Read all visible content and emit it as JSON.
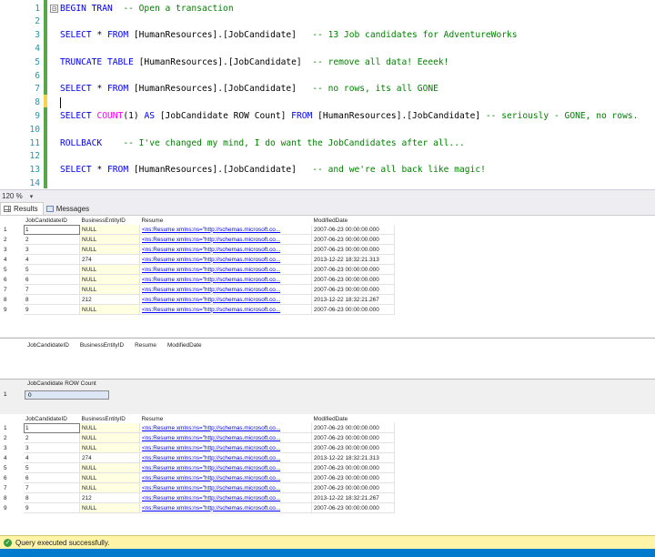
{
  "editor": {
    "lines": [
      {
        "num": "1",
        "fold": "⊟",
        "segs": [
          {
            "c": "kw",
            "t": "BEGIN TRAN"
          },
          {
            "c": "cm",
            "t": "  -- Open a transaction"
          }
        ]
      },
      {
        "num": "2",
        "segs": []
      },
      {
        "num": "3",
        "segs": [
          {
            "c": "kw",
            "t": "SELECT "
          },
          {
            "c": "tx",
            "t": "* "
          },
          {
            "c": "kw",
            "t": "FROM "
          },
          {
            "c": "tx",
            "t": "[HumanResources].[JobCandidate]"
          },
          {
            "c": "cm",
            "t": "   -- 13 Job candidates for AdventureWorks"
          }
        ]
      },
      {
        "num": "4",
        "segs": []
      },
      {
        "num": "5",
        "segs": [
          {
            "c": "kw",
            "t": "TRUNCATE TABLE "
          },
          {
            "c": "tx",
            "t": "[HumanResources].[JobCandidate]"
          },
          {
            "c": "cm",
            "t": "  -- remove all data! Eeeek!"
          }
        ]
      },
      {
        "num": "6",
        "segs": []
      },
      {
        "num": "7",
        "segs": [
          {
            "c": "kw",
            "t": "SELECT "
          },
          {
            "c": "tx",
            "t": "* "
          },
          {
            "c": "kw",
            "t": "FROM "
          },
          {
            "c": "tx",
            "t": "[HumanResources].[JobCandidate]"
          },
          {
            "c": "cm",
            "t": "   -- no rows, its all GONE"
          }
        ]
      },
      {
        "num": "8",
        "caret": true,
        "segs": []
      },
      {
        "num": "9",
        "segs": [
          {
            "c": "kw",
            "t": "SELECT "
          },
          {
            "c": "fn",
            "t": "COUNT"
          },
          {
            "c": "tx",
            "t": "(1) "
          },
          {
            "c": "kw",
            "t": "AS "
          },
          {
            "c": "tx",
            "t": "[JobCandidate ROW Count] "
          },
          {
            "c": "kw",
            "t": "FROM "
          },
          {
            "c": "tx",
            "t": "[HumanResources].[JobCandidate]"
          },
          {
            "c": "cm",
            "t": " -- seriously - GONE, no rows."
          }
        ]
      },
      {
        "num": "10",
        "segs": []
      },
      {
        "num": "11",
        "segs": [
          {
            "c": "kw",
            "t": "ROLLBACK"
          },
          {
            "c": "cm",
            "t": "    -- I've changed my mind, I do want the JobCandidates after all..."
          }
        ]
      },
      {
        "num": "12",
        "segs": []
      },
      {
        "num": "13",
        "segs": [
          {
            "c": "kw",
            "t": "SELECT "
          },
          {
            "c": "tx",
            "t": "* "
          },
          {
            "c": "kw",
            "t": "FROM "
          },
          {
            "c": "tx",
            "t": "[HumanResources].[JobCandidate]"
          },
          {
            "c": "cm",
            "t": "   -- and we're all back like magic!"
          }
        ]
      },
      {
        "num": "14",
        "segs": []
      }
    ]
  },
  "zoom": {
    "level": "120 %",
    "arrow": "▾"
  },
  "tabs": [
    {
      "label": "Results",
      "icon": "grid-icon",
      "active": true
    },
    {
      "label": "Messages",
      "icon": "messages-icon",
      "active": false
    }
  ],
  "columns": [
    "JobCandidateID",
    "BusinessEntityID",
    "Resume",
    "ModifiedDate"
  ],
  "rows": [
    {
      "n": "1",
      "id": "1",
      "be": "NULL",
      "res": "<ns:Resume xmlns:ns=\"http://schemas.microsoft.co...",
      "mod": "2007-06-23 00:00:00.000"
    },
    {
      "n": "2",
      "id": "2",
      "be": "NULL",
      "res": "<ns:Resume xmlns:ns=\"http://schemas.microsoft.co...",
      "mod": "2007-06-23 00:00:00.000"
    },
    {
      "n": "3",
      "id": "3",
      "be": "NULL",
      "res": "<ns:Resume xmlns:ns=\"http://schemas.microsoft.co...",
      "mod": "2007-06-23 00:00:00.000"
    },
    {
      "n": "4",
      "id": "4",
      "be": "274",
      "res": "<ns:Resume xmlns:ns=\"http://schemas.microsoft.co...",
      "mod": "2013-12-22 18:32:21.313"
    },
    {
      "n": "5",
      "id": "5",
      "be": "NULL",
      "res": "<ns:Resume xmlns:ns=\"http://schemas.microsoft.co...",
      "mod": "2007-06-23 00:00:00.000"
    },
    {
      "n": "6",
      "id": "6",
      "be": "NULL",
      "res": "<ns:Resume xmlns:ns=\"http://schemas.microsoft.co...",
      "mod": "2007-06-23 00:00:00.000"
    },
    {
      "n": "7",
      "id": "7",
      "be": "NULL",
      "res": "<ns:Resume xmlns:ns=\"http://schemas.microsoft.co...",
      "mod": "2007-06-23 00:00:00.000"
    },
    {
      "n": "8",
      "id": "8",
      "be": "212",
      "res": "<ns:Resume xmlns:ns=\"http://schemas.microsoft.co...",
      "mod": "2013-12-22 18:32:21.267"
    },
    {
      "n": "9",
      "id": "9",
      "be": "NULL",
      "res": "<ns:Resume xmlns:ns=\"http://schemas.microsoft.co...",
      "mod": "2007-06-23 00:00:00.000"
    }
  ],
  "count_result": {
    "column": "JobCandidate ROW Count",
    "row_num": "1",
    "value": "0"
  },
  "status": {
    "text": "Query executed successfully.",
    "icon": "check-icon"
  },
  "colors": {
    "keyword": "#0000ff",
    "function": "#ff00ff",
    "comment": "#008000",
    "status_bar": "#fff4a8",
    "accent": "#007acc"
  }
}
